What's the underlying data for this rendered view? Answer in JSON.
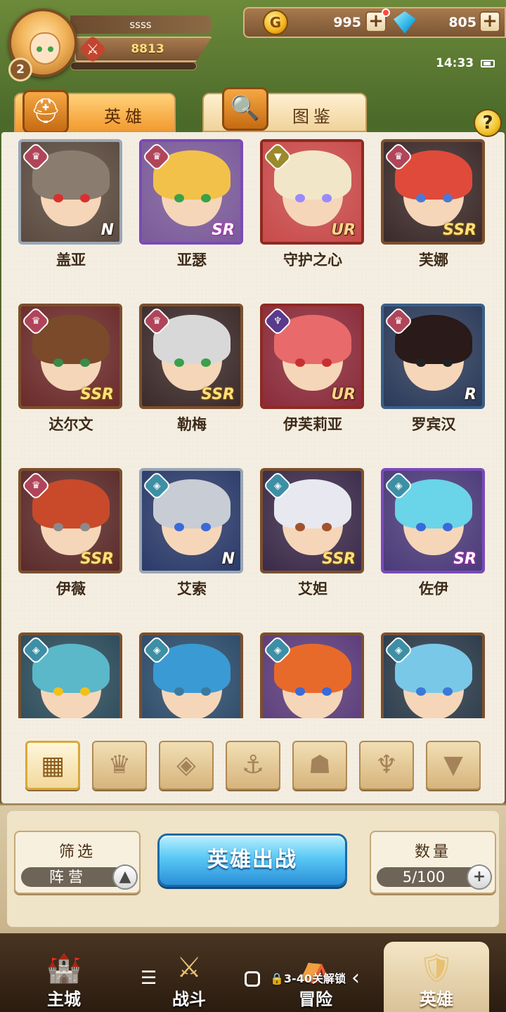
{
  "player": {
    "name": "ssss",
    "level": "2",
    "power": "8813"
  },
  "currency": {
    "gold": "995",
    "gems": "805"
  },
  "status": {
    "time": "14:33"
  },
  "tabs": [
    {
      "label": "英雄"
    },
    {
      "label": "图鉴"
    }
  ],
  "help": "?",
  "heroes": [
    {
      "name": "盖亚",
      "rarity": "N",
      "faction": "flame"
    },
    {
      "name": "亚瑟",
      "rarity": "SR",
      "faction": "flame"
    },
    {
      "name": "守护之心",
      "rarity": "UR",
      "faction": "wing"
    },
    {
      "name": "芙娜",
      "rarity": "SSR",
      "faction": "flame"
    },
    {
      "name": "达尔文",
      "rarity": "SSR",
      "faction": "flame"
    },
    {
      "name": "勒梅",
      "rarity": "SSR",
      "faction": "flame"
    },
    {
      "name": "伊芙莉亚",
      "rarity": "UR",
      "faction": "horn"
    },
    {
      "name": "罗宾汉",
      "rarity": "R",
      "faction": "flame"
    },
    {
      "name": "伊薇",
      "rarity": "SSR",
      "faction": "flame"
    },
    {
      "name": "艾索",
      "rarity": "N",
      "faction": "diamond"
    },
    {
      "name": "艾妲",
      "rarity": "SSR",
      "faction": "diamond"
    },
    {
      "name": "佐伊",
      "rarity": "SR",
      "faction": "diamond"
    },
    {
      "name": "",
      "rarity": "",
      "faction": "diamond"
    },
    {
      "name": "",
      "rarity": "",
      "faction": "diamond"
    },
    {
      "name": "",
      "rarity": "",
      "faction": "diamond"
    },
    {
      "name": "",
      "rarity": "",
      "faction": "diamond"
    }
  ],
  "faction_filters": [
    {
      "icon": "all-grid-icon",
      "active": true
    },
    {
      "icon": "flame-faction-icon"
    },
    {
      "icon": "diamond-faction-icon"
    },
    {
      "icon": "anchor-faction-icon"
    },
    {
      "icon": "beast-faction-icon"
    },
    {
      "icon": "horn-faction-icon"
    },
    {
      "icon": "wing-faction-icon"
    }
  ],
  "filter_box": {
    "title": "筛选",
    "value": "阵营"
  },
  "deploy_button": "英雄出战",
  "count_box": {
    "title": "数量",
    "value": "5/100"
  },
  "nav": [
    {
      "label": "主城",
      "icon": "castle-icon"
    },
    {
      "label": "战斗",
      "icon": "crossed-swords-icon"
    },
    {
      "label": "冒险",
      "icon": "adventure-icon"
    },
    {
      "label": "英雄",
      "icon": "hero-crest-icon",
      "active": true
    }
  ],
  "system_nav": {
    "lock_text": "3-40关解锁"
  },
  "colors": {
    "frame_brown": "#7b4f2c",
    "frame_purple": "#7a4ab8",
    "frame_red": "#8e2a22",
    "frame_silver": "#9aa6b4",
    "frame_blue": "#3a5f86",
    "accent_blue": "#2a8fd8",
    "faction_flame": "#b0455a",
    "faction_diamond": "#3d8fa5",
    "faction_horn": "#5a3a8a",
    "faction_wing": "#9a8a2a"
  }
}
